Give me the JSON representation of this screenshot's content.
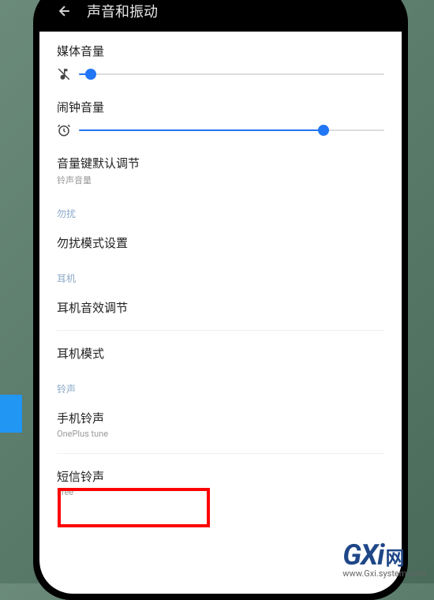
{
  "header": {
    "title": "声音和振动"
  },
  "volumes": {
    "media": {
      "label": "媒体音量",
      "percent": 4
    },
    "alarm": {
      "label": "闹钟音量",
      "percent": 80
    }
  },
  "volumeKey": {
    "title": "音量键默认调节",
    "sub": "铃声音量"
  },
  "sections": {
    "dnd": {
      "header": "勿扰",
      "item": "勿扰模式设置"
    },
    "earphone": {
      "header": "耳机",
      "effect": "耳机音效调节",
      "mode": "耳机模式"
    },
    "ringtone": {
      "header": "铃声",
      "phone": {
        "title": "手机铃声",
        "sub": "OnePlus tune"
      },
      "sms": {
        "title": "短信铃声",
        "sub": "Free"
      }
    }
  },
  "watermark": {
    "main": "GXi",
    "cn": "网",
    "sub": "www.Gxi.system.com"
  }
}
